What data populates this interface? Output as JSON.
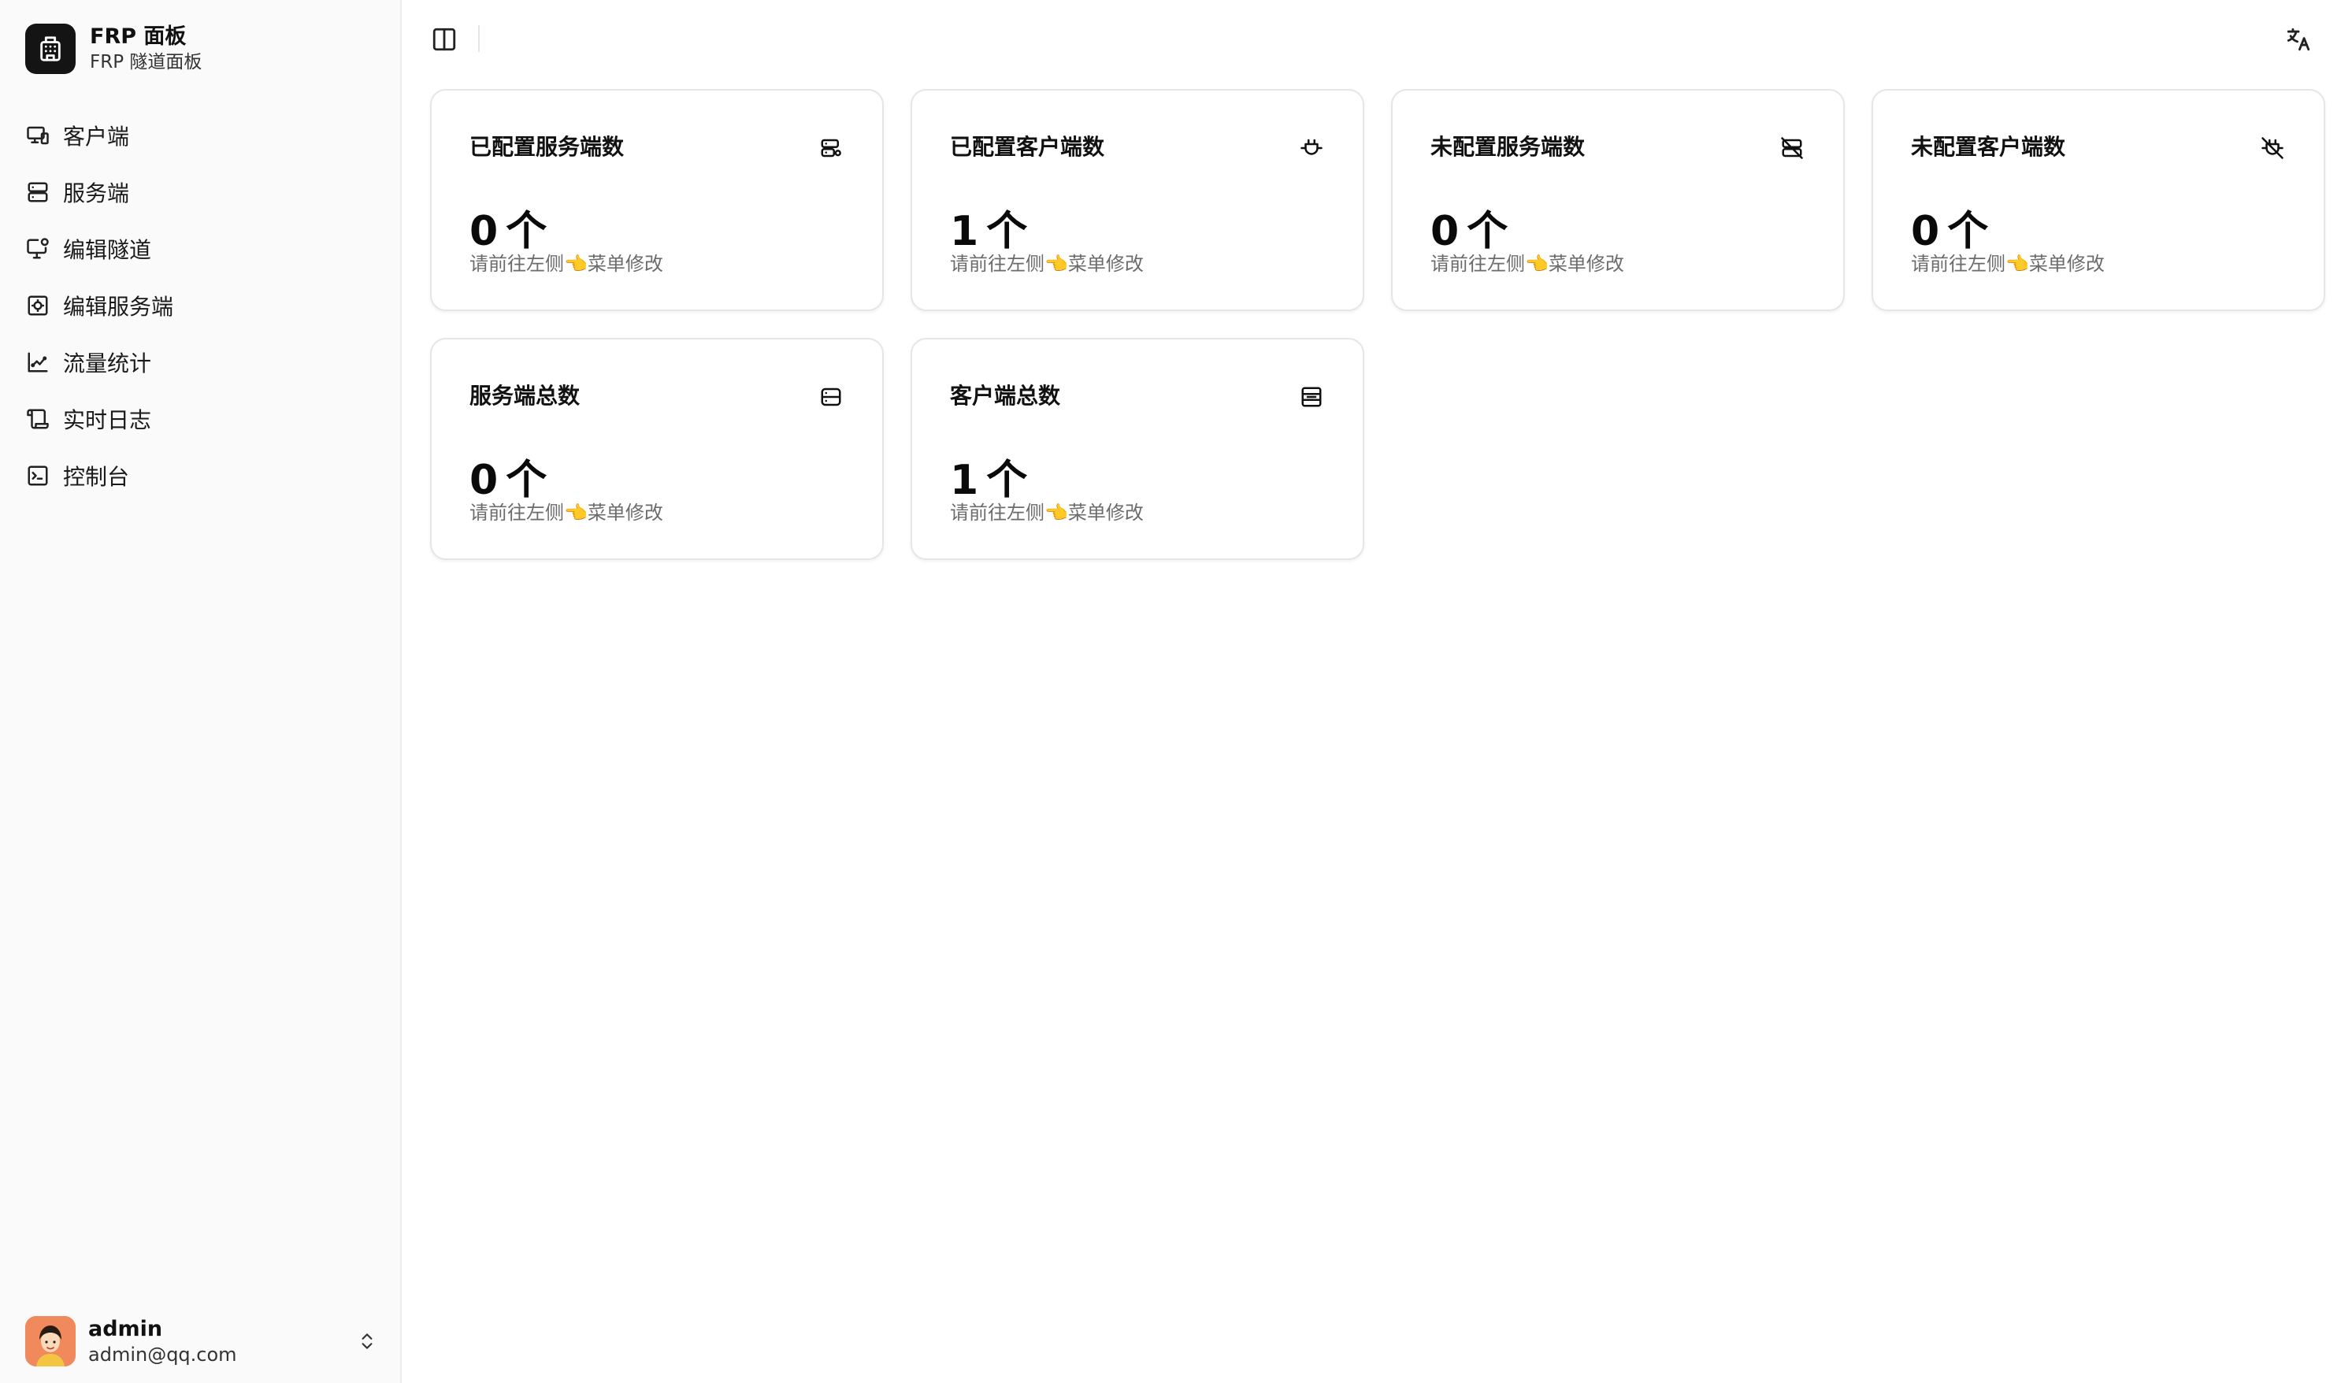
{
  "brand": {
    "title": "FRP 面板",
    "subtitle": "FRP 隧道面板",
    "logo_icon": "building-icon"
  },
  "sidebar": {
    "items": [
      {
        "label": "客户端",
        "icon": "monitor-icon"
      },
      {
        "label": "服务端",
        "icon": "server-icon"
      },
      {
        "label": "编辑隧道",
        "icon": "monitor-edit-icon"
      },
      {
        "label": "编辑服务端",
        "icon": "server-cog-icon"
      },
      {
        "label": "流量统计",
        "icon": "chart-icon"
      },
      {
        "label": "实时日志",
        "icon": "scroll-icon"
      },
      {
        "label": "控制台",
        "icon": "terminal-icon"
      }
    ]
  },
  "user": {
    "name": "admin",
    "email": "admin@qq.com"
  },
  "cards": [
    {
      "title": "已配置服务端数",
      "value": "0",
      "unit": "个",
      "hint": "请前往左侧👈菜单修改",
      "icon": "server-cog-icon"
    },
    {
      "title": "已配置客户端数",
      "value": "1",
      "unit": "个",
      "hint": "请前往左侧👈菜单修改",
      "icon": "plug-icon"
    },
    {
      "title": "未配置服务端数",
      "value": "0",
      "unit": "个",
      "hint": "请前往左侧👈菜单修改",
      "icon": "server-off-icon"
    },
    {
      "title": "未配置客户端数",
      "value": "0",
      "unit": "个",
      "hint": "请前往左侧👈菜单修改",
      "icon": "plug-off-icon"
    },
    {
      "title": "服务端总数",
      "value": "0",
      "unit": "个",
      "hint": "请前往左侧👈菜单修改",
      "icon": "server-icon"
    },
    {
      "title": "客户端总数",
      "value": "1",
      "unit": "个",
      "hint": "请前往左侧👈菜单修改",
      "icon": "list-box-icon"
    }
  ],
  "colors": {
    "sidebar_bg": "#fafafa",
    "logo_bg": "#141414",
    "hint_text": "#6b6b6b",
    "avatar_bg": "#f08a5d"
  }
}
